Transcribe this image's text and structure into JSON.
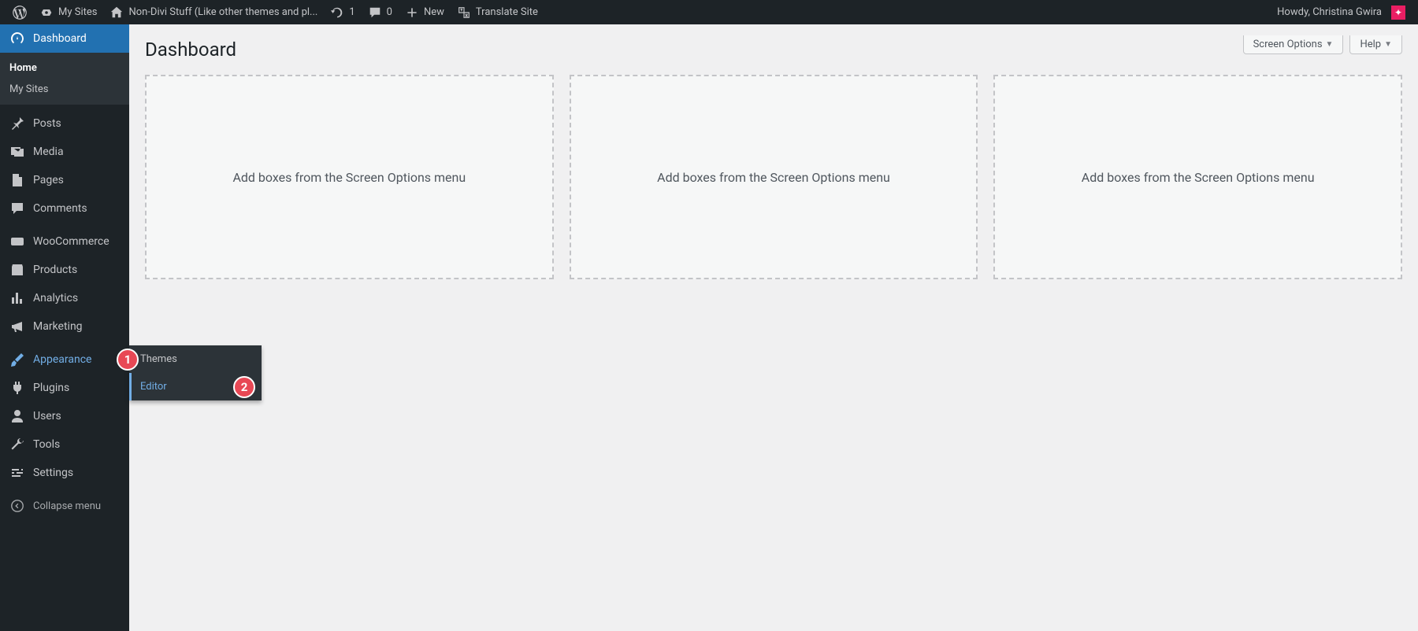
{
  "adminbar": {
    "mysites": "My Sites",
    "sitename": "Non-Divi Stuff (Like other themes and pl...",
    "updates": "1",
    "comments": "0",
    "new": "New",
    "translate": "Translate Site",
    "howdy": "Howdy, Christina Gwira"
  },
  "sidebar": {
    "dashboard": "Dashboard",
    "sub_home": "Home",
    "sub_mysites": "My Sites",
    "posts": "Posts",
    "media": "Media",
    "pages": "Pages",
    "comments": "Comments",
    "woocommerce": "WooCommerce",
    "products": "Products",
    "analytics": "Analytics",
    "marketing": "Marketing",
    "appearance": "Appearance",
    "plugins": "Plugins",
    "users": "Users",
    "tools": "Tools",
    "settings": "Settings",
    "collapse": "Collapse menu"
  },
  "flyout": {
    "themes": "Themes",
    "editor": "Editor"
  },
  "annotations": {
    "one": "1",
    "two": "2"
  },
  "content": {
    "title": "Dashboard",
    "screen_options": "Screen Options",
    "help": "Help",
    "placeholder": "Add boxes from the Screen Options menu"
  }
}
